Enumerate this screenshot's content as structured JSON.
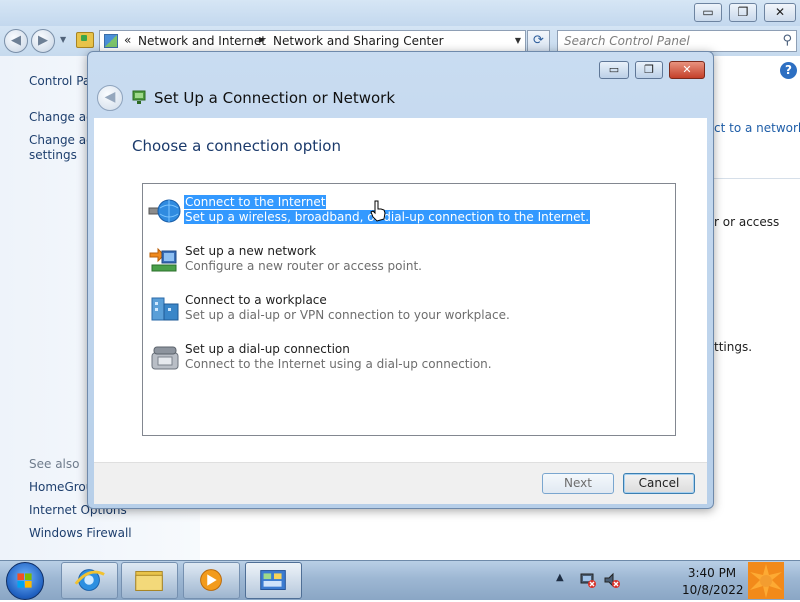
{
  "window": {
    "caption_buttons": {
      "minimize": "▭",
      "restore": "❐",
      "close": "✕"
    }
  },
  "toolbar": {
    "back_glyph": "◀",
    "forward_glyph": "▶",
    "address_prefix": "«",
    "breadcrumbs": [
      "Network and Internet",
      "Network and Sharing Center"
    ],
    "refresh_glyph": "⟳",
    "search_placeholder": "Search Control Panel"
  },
  "sidebar": {
    "control_panel_home": "Control Pa",
    "change_adapter": "Change ad",
    "change_advanced_line1": "Change ad",
    "change_advanced_line2": "settings",
    "see_also": "See also",
    "links": [
      "HomeGrou",
      "Internet Options",
      "Windows Firewall"
    ]
  },
  "background_content": {
    "connect_to_network": "ct to a network",
    "or_access": "r or access",
    "settings": "ttings."
  },
  "dialog": {
    "title": "Set Up a Connection or Network",
    "heading": "Choose a connection option",
    "options": [
      {
        "title": "Connect to the Internet",
        "description": "Set up a wireless, broadband, or dial-up connection to the Internet.",
        "selected": true,
        "icon": "globe-network-icon"
      },
      {
        "title": "Set up a new network",
        "description": "Configure a new router or access point.",
        "selected": false,
        "icon": "router-icon"
      },
      {
        "title": "Connect to a workplace",
        "description": "Set up a dial-up or VPN connection to your workplace.",
        "selected": false,
        "icon": "workplace-icon"
      },
      {
        "title": "Set up a dial-up connection",
        "description": "Connect to the Internet using a dial-up connection.",
        "selected": false,
        "icon": "telephone-icon"
      }
    ],
    "next_label": "Next",
    "cancel_label": "Cancel"
  },
  "taskbar": {
    "items": [
      "internet-explorer-icon",
      "file-explorer-icon",
      "media-player-icon",
      "control-panel-icon"
    ],
    "tray_icons": [
      "show-hidden-icons-icon",
      "network-icon",
      "volume-muted-icon"
    ],
    "time": "3:40 PM",
    "date": "10/8/2022"
  },
  "colors": {
    "selection": "#3399ff",
    "heading": "#1b3a6b",
    "link": "#1e3f6e"
  }
}
